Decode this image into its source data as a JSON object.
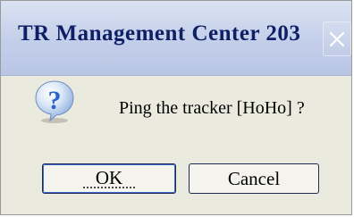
{
  "window": {
    "title": "TR Management Center 203",
    "close_icon": "close-x-icon"
  },
  "dialog": {
    "icon": "question-icon",
    "message": "Ping the tracker [HoHo] ?",
    "ok_label": "OK",
    "cancel_label": "Cancel"
  },
  "colors": {
    "title_text": "#0f1f66",
    "dialog_bg": "#ebeadf",
    "question_blue": "#2a64c9"
  }
}
